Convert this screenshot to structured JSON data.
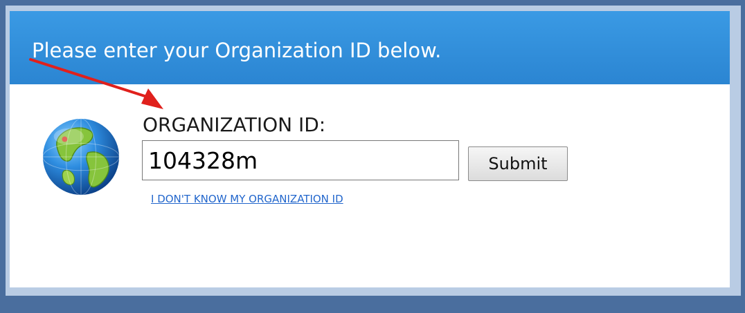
{
  "header": {
    "title": "Please enter your Organization ID below."
  },
  "form": {
    "label": "ORGANIZATION ID:",
    "input_value": "104328m",
    "submit_label": "Submit",
    "help_link": "I DON'T KNOW MY ORGANIZATION ID"
  },
  "icons": {
    "globe": "globe-icon",
    "annotation": "red-arrow-icon"
  },
  "colors": {
    "header_blue": "#2b85d2",
    "page_background": "#4a6e9e",
    "link": "#2266cc",
    "arrow": "#e0201c"
  }
}
